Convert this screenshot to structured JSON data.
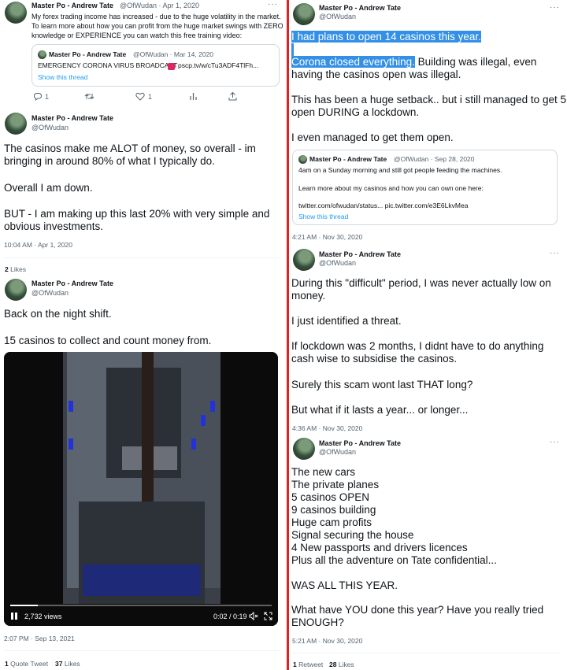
{
  "left": {
    "tweet1": {
      "name": "Master Po - Andrew Tate",
      "handle_date": "@OfWudan · Apr 1, 2020",
      "lines": [
        "My forex trading income has increased - due to the huge volatility in the market.",
        "To learn more about how you can profit from the huge market swings with ZERO",
        "knowledge or EXPERIENCE you can watch this free training video:"
      ],
      "quote": {
        "name": "Master Po - Andrew Tate",
        "handle_date": "@OfWudan · Mar 14, 2020",
        "text": "EMERGENCY CORONA VIRUS BROADCAST",
        "link_text": "pscp.tv/w/cTu3ADF4TlFh...",
        "show_thread": "Show this thread"
      },
      "reply_count": "1",
      "like_count": "1"
    },
    "tweet2": {
      "name": "Master Po - Andrew Tate",
      "handle": "@OfWudan",
      "lines": [
        "The casinos make me ALOT of money, so overall - im",
        "bringing in around 80% of what I typically do.",
        "",
        "Overall I am down.",
        "",
        "BUT - I am making up this last 20% with very simple and",
        "obvious investments."
      ],
      "timestamp": "10:04 AM · Apr 1, 2020",
      "likes_count": "2",
      "likes_label": "Likes"
    },
    "tweet3": {
      "name": "Master Po - Andrew Tate",
      "handle": "@OfWudan",
      "lines": [
        "Back on the night shift.",
        "",
        "15 casinos to collect and count money from."
      ],
      "video": {
        "views": "2,732 views",
        "time": "0:02 / 0:19",
        "progress": 0.105
      },
      "timestamp": "2:07 PM · Sep 13, 2021",
      "quote_count": "1",
      "quote_label": "Quote Tweet",
      "likes_count": "37",
      "likes_label": "Likes"
    }
  },
  "right": {
    "tweet1": {
      "name": "Master Po - Andrew Tate",
      "handle": "@OfWudan",
      "highlight_1": "I had plans to open 14 casinos this year.",
      "highlight_2": "Corona closed everything.",
      "after_highlight": " Building was illegal, even",
      "lines": [
        "having the casinos open was illegal.",
        "",
        "This has been a huge setback.. but i still managed to get 5",
        "open DURING a lockdown.",
        "",
        "I even managed to get them open."
      ],
      "quote": {
        "name": "Master Po - Andrew Tate",
        "handle_date": "@OfWudan · Sep 28, 2020",
        "lines": [
          "4am on a Sunday morning and still got people feeding the machines.",
          "",
          "Learn more about my casinos and how you can own one here:",
          "",
          "twitter.com/ofwudan/status...  pic.twitter.com/e3E6LkvMea"
        ],
        "show_thread": "Show this thread"
      },
      "timestamp": "4:21 AM · Nov 30, 2020"
    },
    "tweet2": {
      "name": "Master Po - Andrew Tate",
      "handle": "@OfWudan",
      "lines": [
        "During this \"difficult\" period, I was never actually low on",
        "money.",
        "",
        "I just identified a threat.",
        "",
        "If lockdown was 2 months, I didnt have to do anything",
        "cash wise to subsidise the casinos.",
        "",
        "Surely this scam wont last THAT long?",
        "",
        "But what if it lasts a year... or longer..."
      ],
      "timestamp": "4:36 AM · Nov 30, 2020"
    },
    "tweet3": {
      "name": "Master Po - Andrew Tate",
      "handle": "@OfWudan",
      "lines": [
        "The new cars",
        "The private planes",
        "5 casinos OPEN",
        "9 casinos building",
        "Huge cam profits",
        "Signal securing the house",
        "4 New passports and drivers licences",
        "Plus all the adventure on Tate confidential...",
        "",
        "WAS ALL THIS YEAR.",
        "",
        "What have YOU done this year? Have you really tried",
        "ENOUGH?"
      ],
      "timestamp": "5:21 AM · Nov 30, 2020",
      "retweet_count": "1",
      "retweet_label": "Retweet",
      "likes_count": "28",
      "likes_label": "Likes"
    }
  },
  "icons": {
    "more": "···",
    "reply": "reply-icon",
    "retweet": "retweet-icon",
    "like": "heart-icon",
    "analytics": "analytics-icon",
    "share": "share-icon",
    "pause": "pause-icon",
    "volume": "volume-icon",
    "fullscreen": "fullscreen-icon"
  },
  "colors": {
    "divider": "#e0211f",
    "link": "#1d9bf0",
    "highlight": "#3390e6"
  }
}
